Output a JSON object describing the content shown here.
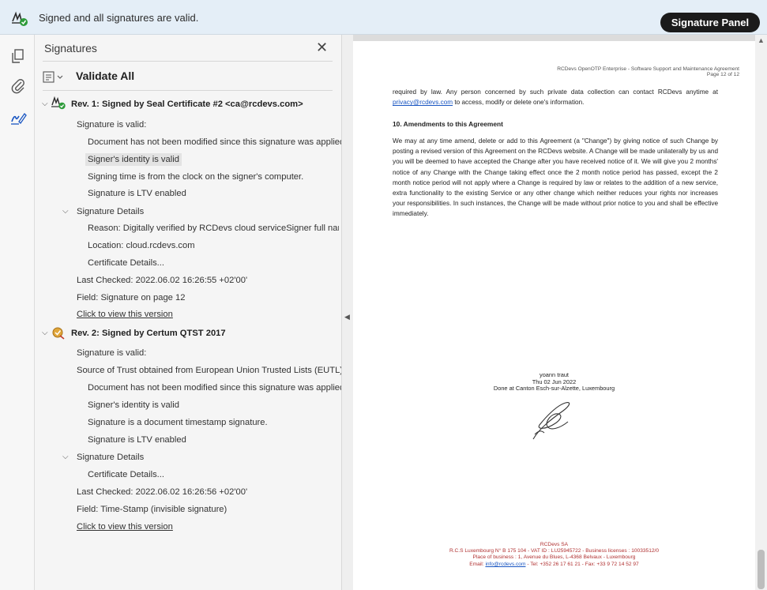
{
  "topbar": {
    "status_message": "Signed and all signatures are valid.",
    "signature_panel_button": "Signature Panel"
  },
  "panel": {
    "title": "Signatures",
    "close_glyph": "✕",
    "validate_all": "Validate All"
  },
  "rev1": {
    "title": "Rev. 1: Signed by Seal Certificate #2 <ca@rcdevs.com>",
    "valid": "Signature is valid:",
    "not_modified": "Document has not been modified since this signature was applied",
    "identity": "Signer's identity is valid",
    "signing_time": "Signing time is from the clock on the signer's computer.",
    "ltv": "Signature is LTV enabled",
    "details": "Signature Details",
    "reason": "Reason: Digitally verified by RCDevs cloud serviceSigner full name: yoan",
    "location": "Location: cloud.rcdevs.com",
    "cert_details": "Certificate Details...",
    "last_checked": "Last Checked: 2022.06.02 16:26:55 +02'00'",
    "field": "Field: Signature on page 12",
    "view_link": "Click to view this version"
  },
  "rev2": {
    "title": "Rev. 2: Signed by Certum QTST 2017",
    "valid": "Signature is valid:",
    "source_trust": "Source of Trust obtained from European Union Trusted Lists (EUTL).",
    "not_modified": "Document has not been modified since this signature was applied",
    "identity": "Signer's identity is valid",
    "timestamp": "Signature is a document timestamp signature.",
    "ltv": "Signature is LTV enabled",
    "details": "Signature Details",
    "cert_details": "Certificate Details...",
    "last_checked": "Last Checked: 2022.06.02 16:26:56 +02'00'",
    "field": "Field: Time-Stamp (invisible signature)",
    "view_link": "Click to view this version"
  },
  "document": {
    "header_line1": "RCDevs OpenOTP Enterprise - Software Support and Maintenance Agreement",
    "header_line2": "Page 12 of 12",
    "para1_a": "required by law. Any person concerned by such private data collection can contact RCDevs anytime at ",
    "para1_link": "privacy@rcdevs.com",
    "para1_b": " to access, modify or delete one's information.",
    "section_heading": "10.  Amendments to this Agreement",
    "para2": "We may at any time amend, delete or add to this Agreement (a \"Change\") by giving notice of such Change by posting a revised version of this Agreement on the RCDevs website. A Change will be made unilaterally by us and you will be deemed to have accepted the Change after you have received notice of it. We will give you 2 months' notice of any Change with the Change taking effect once the 2 month notice period has passed, except the 2 month notice period will not apply where a Change is required by law or relates to the addition of a new service, extra functionality to the existing Service or any other change which neither reduces your rights nor increases your responsibilities. In such instances, the Change will be made without prior notice to you and shall be effective immediately.",
    "sig_name": "yoann traut",
    "sig_date": "Thu 02 Jun 2022",
    "sig_place": "Done at Canton Esch-sur-Alzette, Luxembourg",
    "footer_company": "RCDevs SA",
    "footer_line2": "R.C.S Luxembourg N° B 175 104 - VAT ID : LU25945722  - Business licenses : 10033512/0",
    "footer_line3": "Place of business : 1, Avenue du Blues, L-4368 Belvaux - Luxembourg",
    "footer_email_label": "Email: ",
    "footer_email": "info@rcdevs.com",
    "footer_line4_rest": " - Tel: +352 26 17 61 21 - Fax: +33 9 72 14 52 97"
  },
  "colors": {
    "topbar_bg": "#e4eef7",
    "button_bg": "#1b1b1b",
    "valid_green": "#2e9b3a",
    "link_blue": "#1a56c2",
    "footer_red": "#b03030"
  },
  "icons": {
    "topbar": "signature-valid-icon",
    "rail": [
      "copy-pages-icon",
      "paperclip-icon",
      "signature-pen-icon"
    ],
    "panel_close": "close-icon",
    "options": "options-menu-icon",
    "rev1": "signature-valid-icon",
    "rev2": "certificate-seal-icon"
  }
}
